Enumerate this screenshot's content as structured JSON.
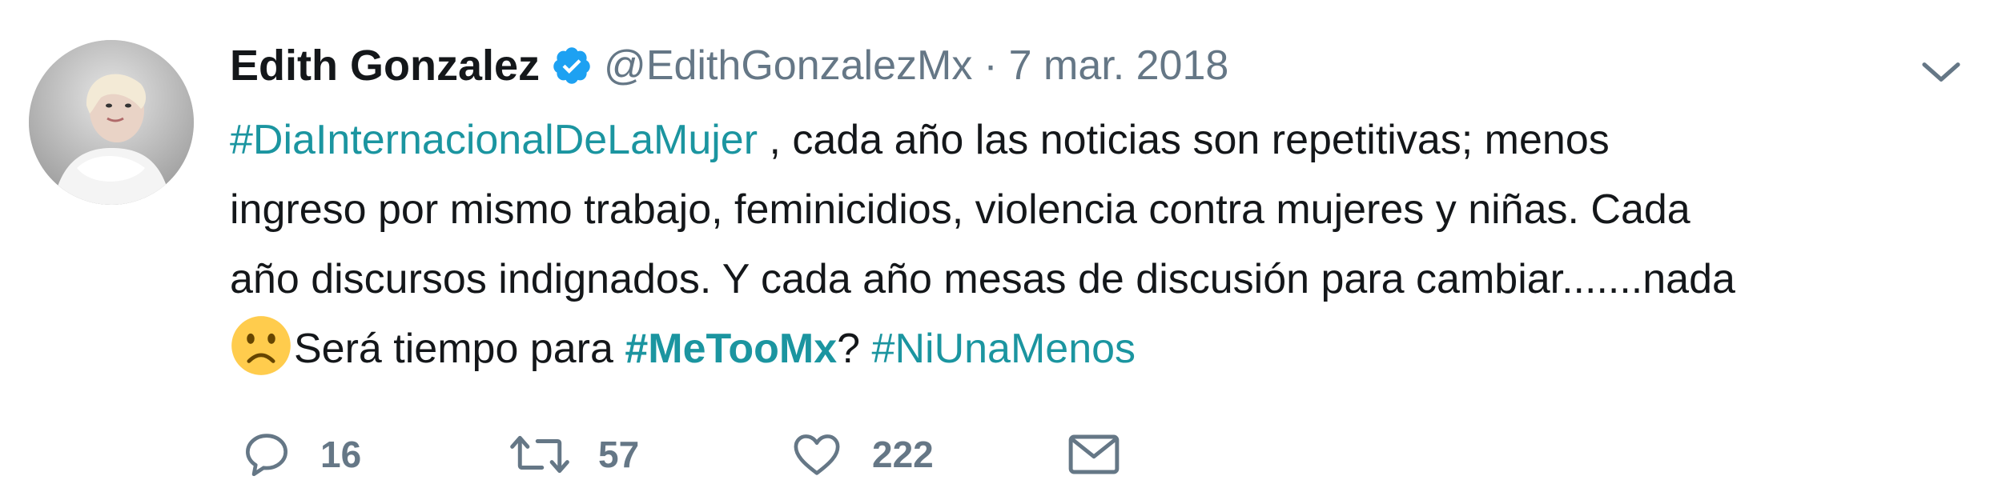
{
  "tweet": {
    "author_name": "Edith Gonzalez",
    "handle": "@EdithGonzalezMx",
    "separator": "·",
    "date": "7 mar. 2018",
    "verified_icon": "verified-badge-icon",
    "caret_icon": "chevron-down-icon",
    "line1": {
      "hashtag": "#DiaInternacionalDeLaMujer",
      "text": " , cada año las noticias son repetitivas;  menos"
    },
    "line2": "ingreso por mismo trabajo, feminicidios, violencia contra mujeres y niñas. Cada",
    "line3": "año discursos indignados. Y cada año mesas de discusión para cambiar.......nada",
    "line4": {
      "emoji": "frowning-face-emoji",
      "text_before": "Será tiempo para ",
      "hashtag1": "#MeTooMx",
      "text_between": "? ",
      "hashtag2": "#NiUnaMenos"
    },
    "actions": {
      "reply_count": "16",
      "retweet_count": "57",
      "like_count": "222"
    },
    "colors": {
      "text": "#14171a",
      "secondary": "#657786",
      "hashtag": "#1b95a0",
      "verified": "#1da1f2"
    }
  }
}
